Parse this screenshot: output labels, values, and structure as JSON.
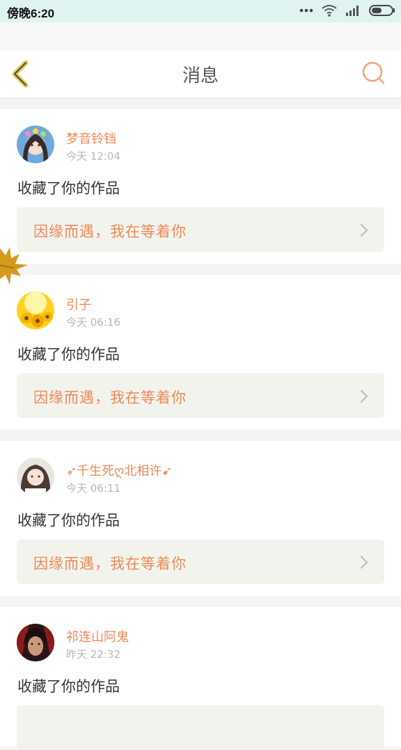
{
  "status_bar": {
    "time": "傍晚6:20"
  },
  "header": {
    "title": "消息"
  },
  "colors": {
    "accent": "#ee8a55",
    "back_icon": "#e8c74a",
    "search_icon": "#f2a27a",
    "ref_background": "#f3f3ee"
  },
  "messages": [
    {
      "username": "梦音铃铛",
      "time": "今天 12:04",
      "action": "收藏了你的作品",
      "reference": "因缘而遇，我在等着你"
    },
    {
      "username": "引子",
      "time": "今天 06:16",
      "action": "收藏了你的作品",
      "reference": "因缘而遇，我在等着你"
    },
    {
      "username": "➶千生死ღ北相许➹",
      "time": "今天 06:11",
      "action": "收藏了你的作品",
      "reference": "因缘而遇，我在等着你"
    },
    {
      "username": "祁连山阿鬼",
      "time": "昨天 22:32",
      "action": "收藏了你的作品",
      "reference": ""
    }
  ]
}
